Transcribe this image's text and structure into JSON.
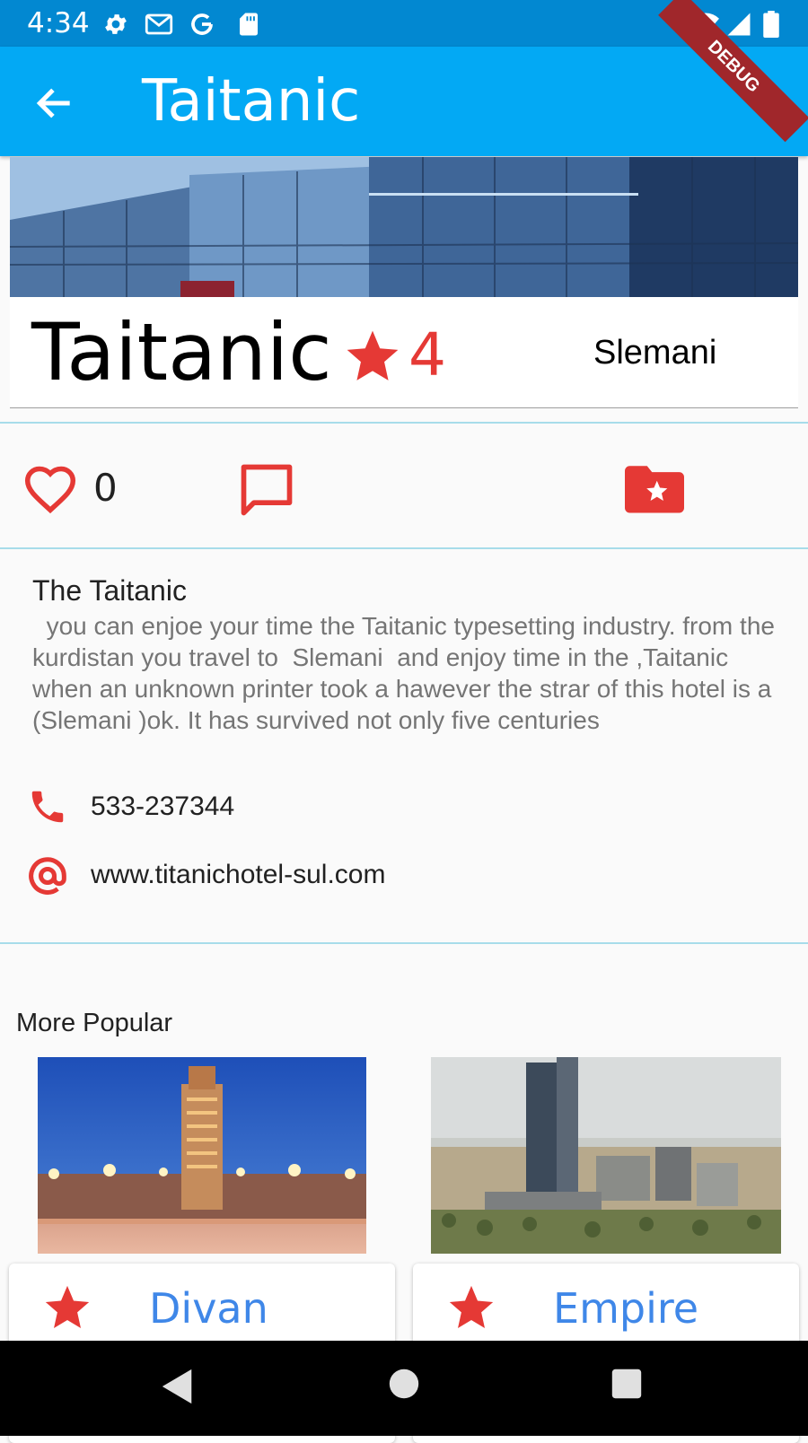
{
  "status_bar": {
    "time": "4:34",
    "icons": [
      "settings-icon",
      "gmail-icon",
      "google-icon",
      "sd-card-icon",
      "wifi-icon",
      "signal-icon",
      "battery-icon"
    ]
  },
  "debug_banner": "DEBUG",
  "app_bar": {
    "back_icon": "arrow-back-icon",
    "title": "Taitanic"
  },
  "hotel": {
    "name": "Taitanic",
    "rating": "4",
    "city": "Slemani"
  },
  "actions": {
    "like_count": "0",
    "icons": [
      "heart-outline-icon",
      "comment-icon",
      "folder-star-icon"
    ]
  },
  "description": {
    "title": "The Taitanic",
    "body": "  you can enjoe your time the Taitanic typesetting industry. from the kurdistan you travel to  Slemani  and enjoy time in the ,Taitanic when an unknown printer took a hawever the strar of this hotel is a (Slemani )ok. It has survived not only five centuries"
  },
  "contact": {
    "phone": "533-237344",
    "website": "www.titanichotel-sul.com"
  },
  "more_popular": {
    "title": "More Popular",
    "items": [
      {
        "name": "Divan"
      },
      {
        "name": "Empire"
      }
    ]
  },
  "colors": {
    "status_bar": "#0288d1",
    "app_bar": "#03a9f4",
    "accent_red": "#e53935",
    "link_blue": "#3f87e8",
    "divider": "#a7dcea"
  }
}
